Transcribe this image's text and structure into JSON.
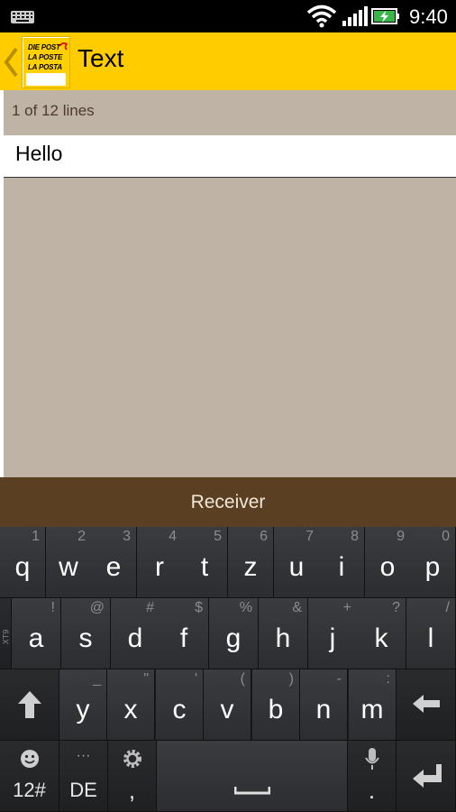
{
  "status_bar": {
    "time": "9:40",
    "icons": [
      "keyboard-icon",
      "wifi-icon",
      "signal-icon",
      "battery-charging-icon"
    ]
  },
  "action_bar": {
    "title": "Text",
    "logo_lines": [
      "DIE POST",
      "LA POSTE",
      "LA POSTA"
    ]
  },
  "content": {
    "lines_counter": "1 of 12 lines",
    "text_value": "Hello"
  },
  "receiver_button": {
    "label": "Receiver"
  },
  "keyboard": {
    "row1": [
      {
        "key": "q",
        "hint": "1"
      },
      {
        "key": "w",
        "hint": "2"
      },
      {
        "key": "e",
        "hint": "3"
      },
      {
        "key": "r",
        "hint": "4"
      },
      {
        "key": "t",
        "hint": "5"
      },
      {
        "key": "z",
        "hint": "6"
      },
      {
        "key": "u",
        "hint": "7"
      },
      {
        "key": "i",
        "hint": "8"
      },
      {
        "key": "o",
        "hint": "9"
      },
      {
        "key": "p",
        "hint": "0"
      }
    ],
    "row2": [
      {
        "key": "a",
        "hint": "!"
      },
      {
        "key": "s",
        "hint": "@"
      },
      {
        "key": "d",
        "hint": "#"
      },
      {
        "key": "f",
        "hint": "$"
      },
      {
        "key": "g",
        "hint": "%"
      },
      {
        "key": "h",
        "hint": "&"
      },
      {
        "key": "j",
        "hint": "+"
      },
      {
        "key": "k",
        "hint": "?"
      },
      {
        "key": "l",
        "hint": "/"
      }
    ],
    "row2_side_label": "XT9",
    "row3": [
      {
        "key": "y",
        "hint": "_"
      },
      {
        "key": "x",
        "hint": "\""
      },
      {
        "key": "c",
        "hint": "'"
      },
      {
        "key": "v",
        "hint": "("
      },
      {
        "key": "b",
        "hint": ")"
      },
      {
        "key": "n",
        "hint": "-"
      },
      {
        "key": "m",
        "hint": ":"
      }
    ],
    "row4": {
      "symbols_label": "12#",
      "language_label": "DE",
      "language_hint": "···",
      "comma_label": ",",
      "period_label": "."
    },
    "colors": {
      "accent": "#ffcc00",
      "receiver_bg": "#5a3f23",
      "content_bg": "#bfb3a5"
    }
  }
}
